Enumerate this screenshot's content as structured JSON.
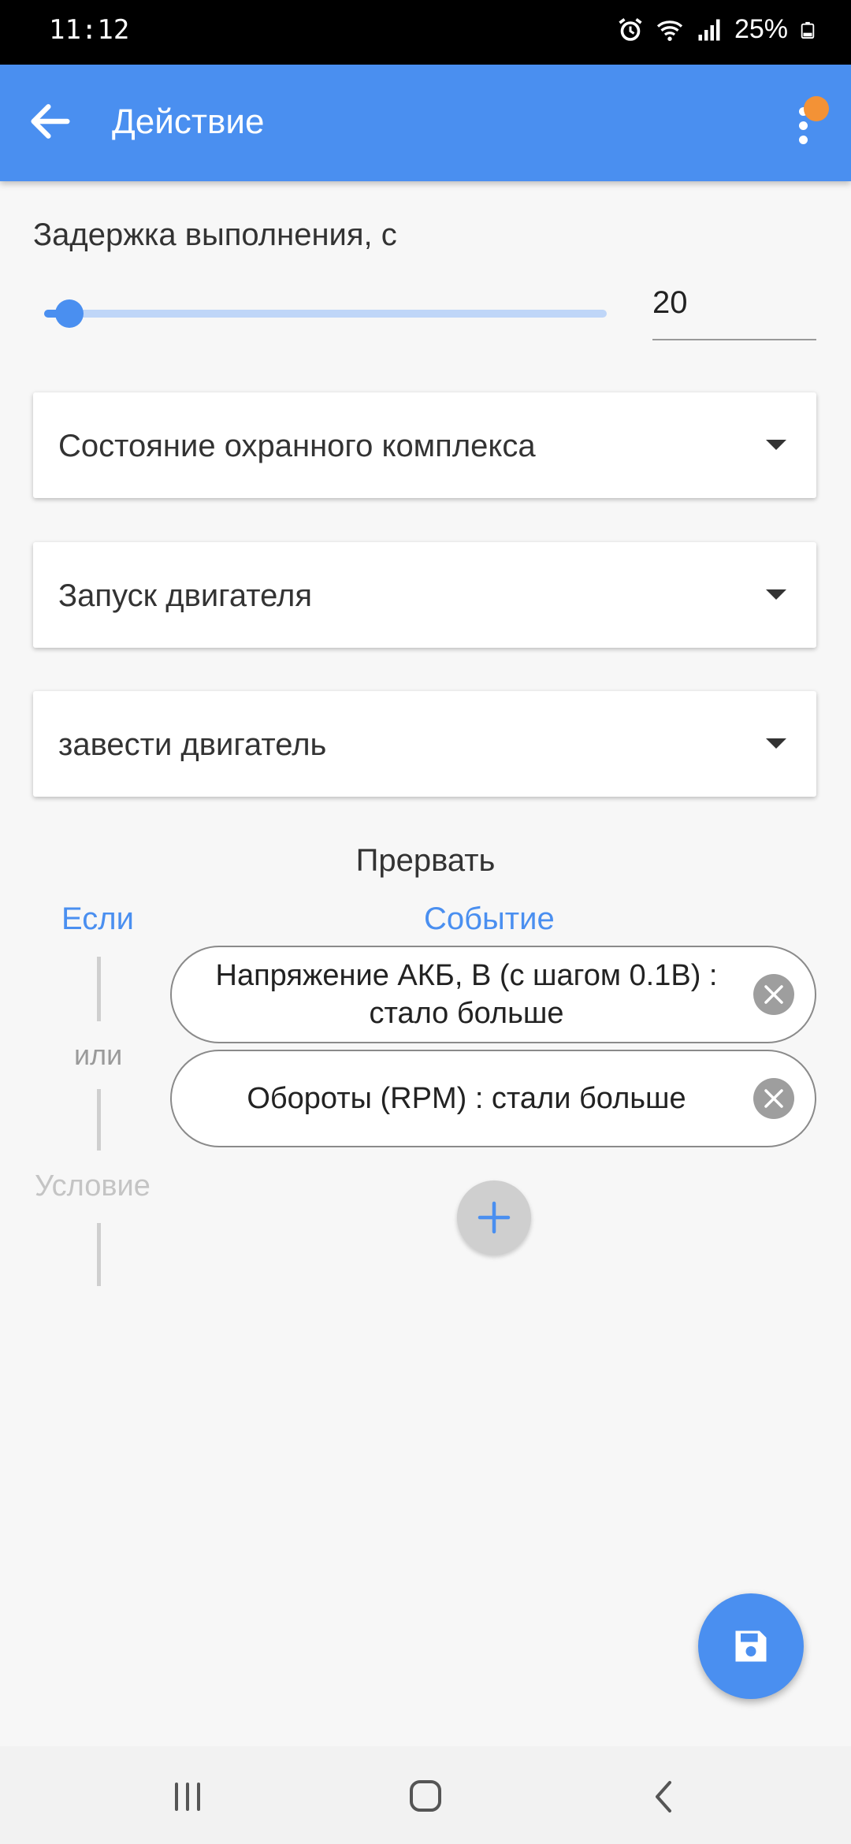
{
  "status_bar": {
    "time": "11:12",
    "battery": "25%",
    "icons": [
      "alarm-icon",
      "wifi-icon",
      "signal-icon",
      "battery-icon"
    ]
  },
  "app_bar": {
    "title": "Действие",
    "back_icon": "arrow-back-icon",
    "menu_icon": "more-vert-icon",
    "notification_color": "#f39236"
  },
  "delay": {
    "label": "Задержка выполнения, с",
    "value": "20",
    "slider_level": 0.03
  },
  "dropdowns": [
    {
      "label": "Состояние охранного комплекса"
    },
    {
      "label": "Запуск двигателя"
    },
    {
      "label": "завести двигатель"
    }
  ],
  "interrupt": {
    "title": "Прервать",
    "if_label": "Если",
    "event_label": "Событие",
    "or_label": "или",
    "condition_label": "Условие",
    "events": [
      {
        "text": "Напряжение АКБ, В (с шагом 0.1В) : стало больше"
      },
      {
        "text": "Обороты (RPM) : стали больше"
      }
    ]
  },
  "actions": {
    "add_icon": "plus-icon",
    "save_icon": "save-icon"
  },
  "colors": {
    "accent": "#4a8ff0",
    "background": "#f7f7f7"
  },
  "nav_bar": {
    "icons": [
      "recent-apps-icon",
      "home-icon",
      "back-nav-icon"
    ]
  }
}
